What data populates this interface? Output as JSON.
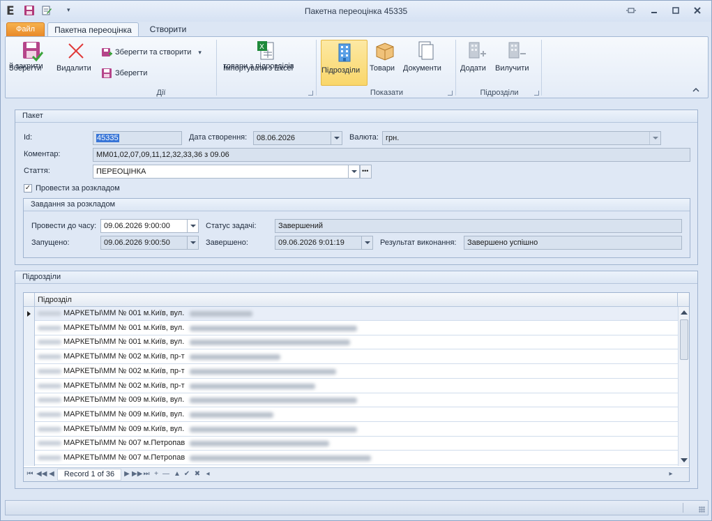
{
  "window": {
    "title": "Пакетна переоцінка 45335",
    "app_letter": "E"
  },
  "tabs": {
    "file": "Файл",
    "active": "Пакетна переоцінка",
    "create": "Створити"
  },
  "ribbon": {
    "actions_group": "Дії",
    "save_close": [
      "Зберегти",
      "й закрити"
    ],
    "delete": "Видалити",
    "save_create": "Зберегти та створити",
    "save": "Зберегти",
    "import": [
      "Імпортувати з Excel",
      "товари з підрозділів"
    ],
    "show_group": "Показати",
    "divisions": "Підрозділи",
    "goods": "Товари",
    "documents": "Документи",
    "divisions_group": "Підрозділи",
    "add": "Додати",
    "exclude": "Вилучити"
  },
  "package": {
    "header": "Пакет",
    "id_label": "Id:",
    "id_value": "45335",
    "created_label": "Дата створення:",
    "created_value": "08.06.2026",
    "currency_label": "Валюта:",
    "currency_value": "грн.",
    "comment_label": "Коментар:",
    "comment_value": "ММ01,02,07,09,11,12,32,33,36 з 09.06",
    "article_label": "Стаття:",
    "article_value": "ПЕРЕОЦІНКА",
    "schedule_checkbox": "Провести за розкладом",
    "schedule_checked": true
  },
  "schedule": {
    "header": "Завдання за розкладом",
    "until_label": "Провести до часу:",
    "until_value": "09.06.2026 9:00:00",
    "status_label": "Статус задачі:",
    "status_value": "Завершений",
    "started_label": "Запущено:",
    "started_value": "09.06.2026 9:00:50",
    "finished_label": "Завершено:",
    "finished_value": "09.06.2026 9:01:19",
    "result_label": "Результат виконання:",
    "result_value": "Завершено успішно"
  },
  "divisions": {
    "header": "Підрозділи",
    "column": "Підрозділ",
    "rows": [
      "МАРКЕТЫ\\ММ № 001 м.Київ, вул.",
      "МАРКЕТЫ\\ММ № 001 м.Київ, вул.",
      "МАРКЕТЫ\\ММ № 001 м.Київ, вул.",
      "МАРКЕТЫ\\ММ № 002 м.Київ, пр-т",
      "МАРКЕТЫ\\ММ № 002 м.Київ, пр-т",
      "МАРКЕТЫ\\ММ № 002 м.Київ, пр-т",
      "МАРКЕТЫ\\ММ № 009 м.Київ, вул.",
      "МАРКЕТЫ\\ММ № 009 м.Київ, вул.",
      "МАРКЕТЫ\\ММ № 009 м.Київ, вул.",
      "МАРКЕТЫ\\ММ № 007 м.Петропав",
      "МАРКЕТЫ\\ММ № 007 м.Петропав"
    ],
    "record_text": "Record 1 of 36"
  }
}
